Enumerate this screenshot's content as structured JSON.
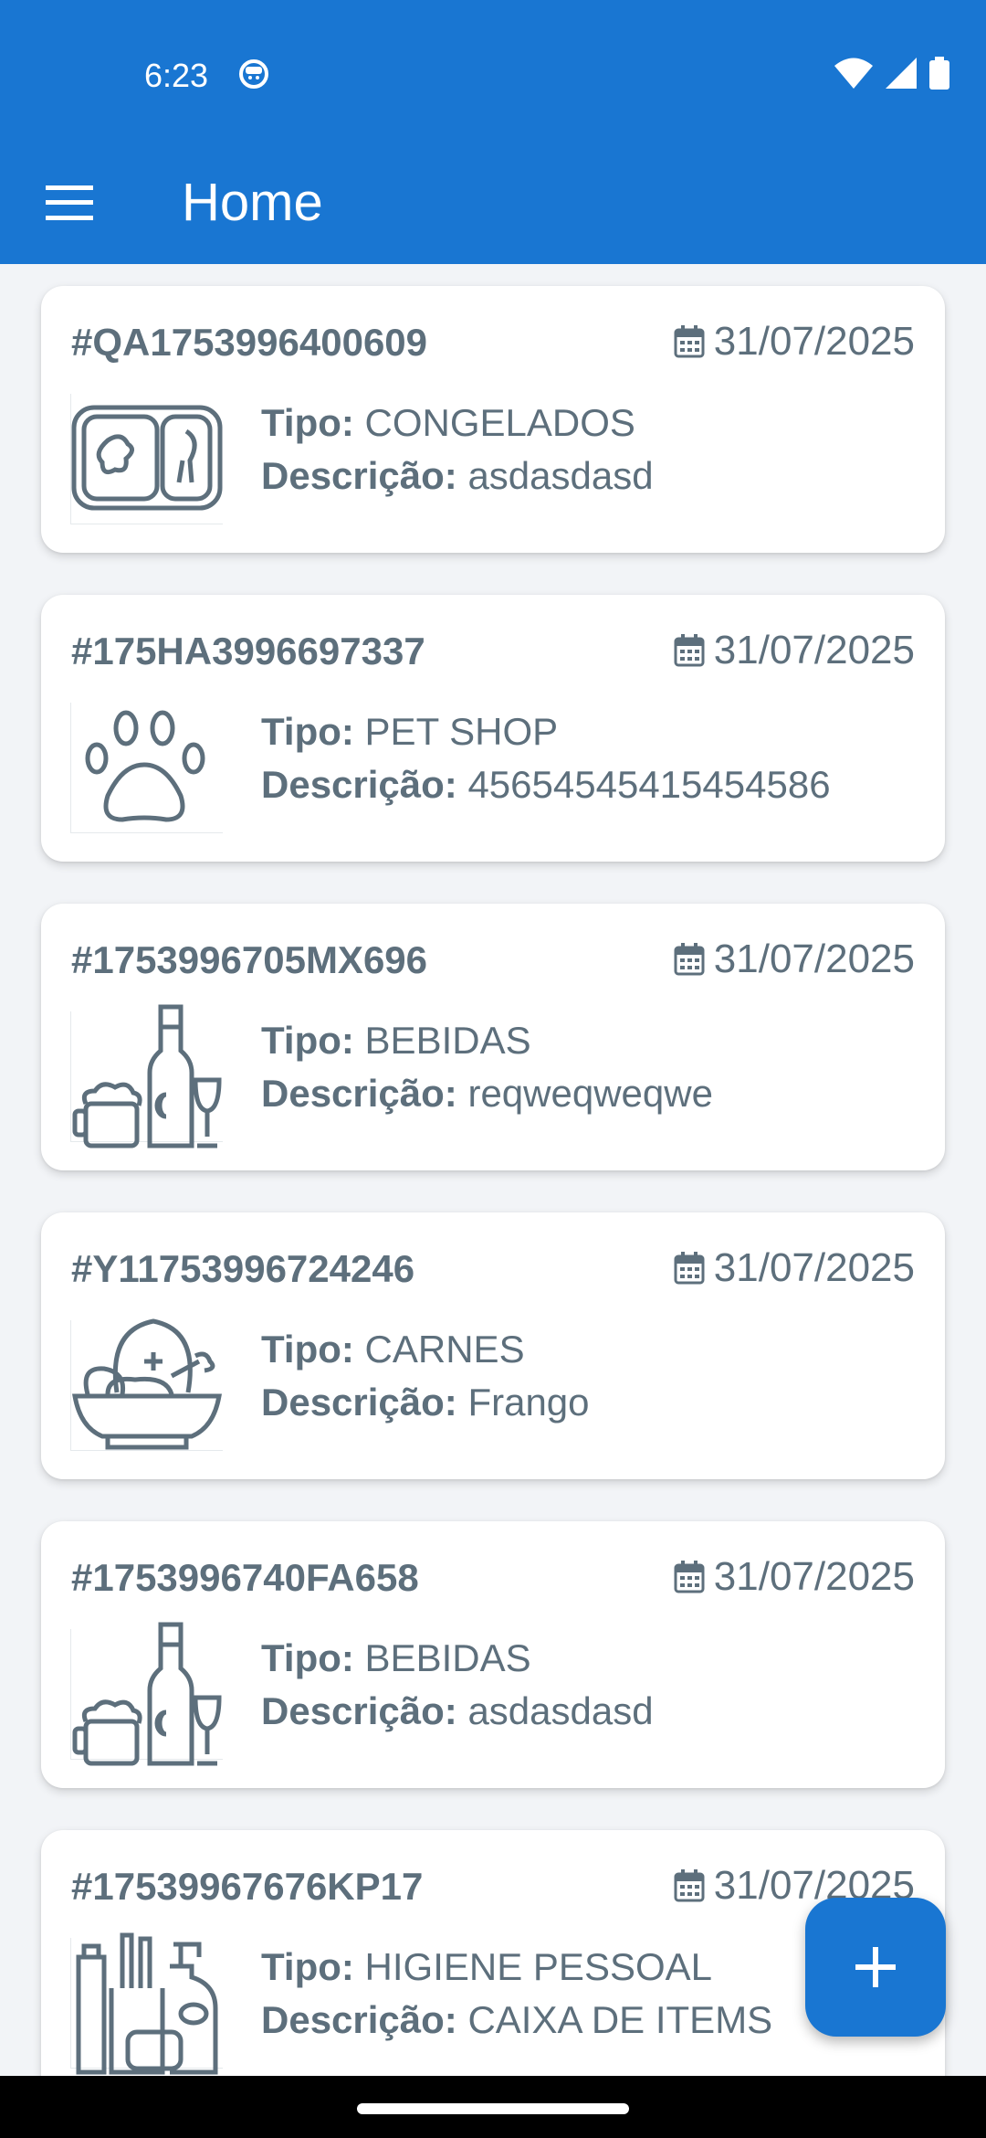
{
  "status_bar": {
    "time": "6:23"
  },
  "app_bar": {
    "title": "Home"
  },
  "labels": {
    "tipo": "Tipo:",
    "descricao": "Descrição:"
  },
  "colors": {
    "primary": "#1976d2",
    "text": "#5d6f7c",
    "background": "#f2f4f7"
  },
  "items": [
    {
      "code": "#QA1753996400609",
      "date": "31/07/2025",
      "tipo": "CONGELADOS",
      "descricao": "asdasdasd",
      "icon": "frozen-food-icon"
    },
    {
      "code": "#175HA3996697337",
      "date": "31/07/2025",
      "tipo": "PET SHOP",
      "descricao": "45654545415454586",
      "icon": "paw-icon"
    },
    {
      "code": "#1753996705MX696",
      "date": "31/07/2025",
      "tipo": "BEBIDAS",
      "descricao": "reqweqweqwe",
      "icon": "drinks-icon"
    },
    {
      "code": "#Y11753996724246",
      "date": "31/07/2025",
      "tipo": "CARNES",
      "descricao": "Frango",
      "icon": "meat-bowl-icon"
    },
    {
      "code": "#1753996740FA658",
      "date": "31/07/2025",
      "tipo": "BEBIDAS",
      "descricao": "asdasdasd",
      "icon": "drinks-icon"
    },
    {
      "code": "#17539967676KP17",
      "date": "31/07/2025",
      "tipo": "HIGIENE PESSOAL",
      "descricao": "CAIXA DE ITEMS",
      "icon": "hygiene-icon"
    }
  ]
}
